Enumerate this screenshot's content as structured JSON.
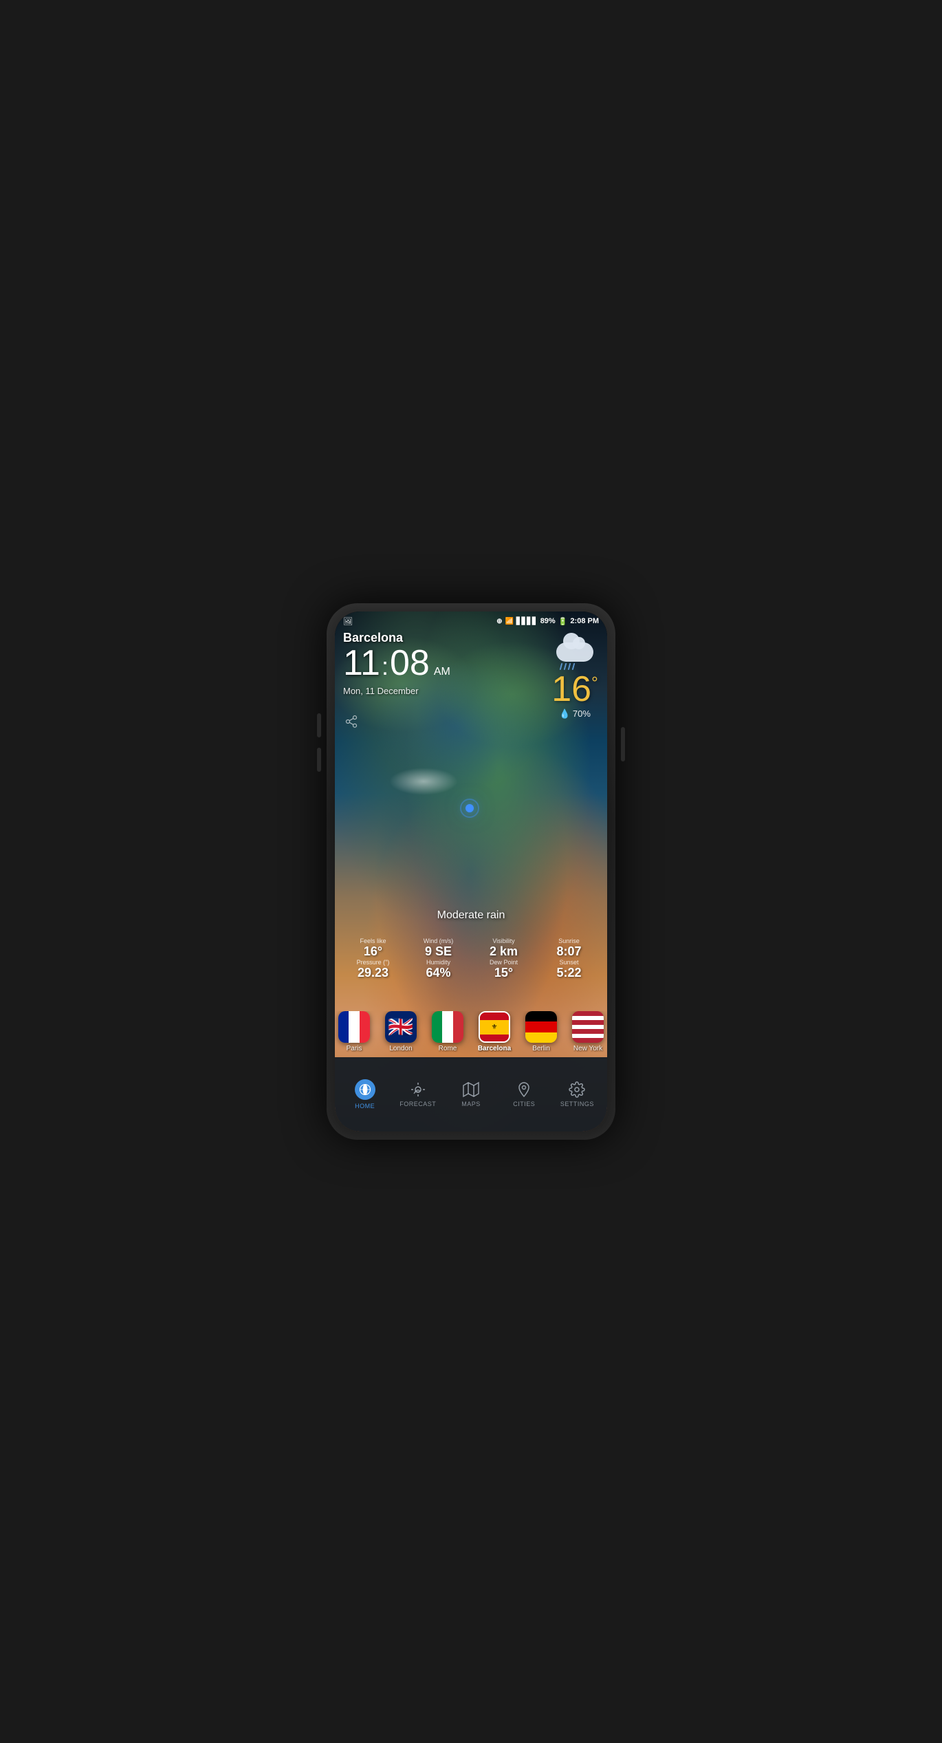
{
  "phone": {
    "status_bar": {
      "left_icon": "📷",
      "location_icon": "⊕",
      "wifi_icon": "wifi",
      "signal_icon": "signal",
      "battery_percent": "89%",
      "battery_icon": "🔋",
      "time": "2:08 PM"
    },
    "weather": {
      "city": "Barcelona",
      "time_hour": "11",
      "time_min": "08",
      "time_ampm": "AM",
      "date": "Mon, 11 December",
      "temperature": "16",
      "temp_unit": "°",
      "humidity_label": "💧 70%",
      "condition": "Moderate rain",
      "feels_like_label": "Feels like",
      "feels_like_value": "16°",
      "wind_label": "Wind (m/s)",
      "wind_value": "9 SE",
      "visibility_label": "Visibility",
      "visibility_value": "2 km",
      "sunrise_label": "Sunrise",
      "sunrise_value": "8:07",
      "pressure_label": "Pressure (\")",
      "pressure_value": "29.23",
      "humidity_label2": "Humidity",
      "humidity_value": "64%",
      "dewpoint_label": "Dew Point",
      "dewpoint_value": "15°",
      "sunset_label": "Sunset",
      "sunset_value": "5:22"
    },
    "cities": [
      {
        "name": "Paris",
        "flag": "fr",
        "active": false
      },
      {
        "name": "London",
        "flag": "uk",
        "active": false
      },
      {
        "name": "Rome",
        "flag": "it",
        "active": false
      },
      {
        "name": "Barcelona",
        "flag": "es",
        "active": true
      },
      {
        "name": "Berlin",
        "flag": "de",
        "active": false
      },
      {
        "name": "New York",
        "flag": "us",
        "active": false
      }
    ],
    "nav": {
      "items": [
        {
          "id": "home",
          "label": "HOME",
          "active": true
        },
        {
          "id": "forecast",
          "label": "FORECAST",
          "active": false
        },
        {
          "id": "maps",
          "label": "MAPS",
          "active": false
        },
        {
          "id": "cities",
          "label": "CITIES",
          "active": false
        },
        {
          "id": "settings",
          "label": "SETTINGS",
          "active": false
        }
      ]
    }
  }
}
